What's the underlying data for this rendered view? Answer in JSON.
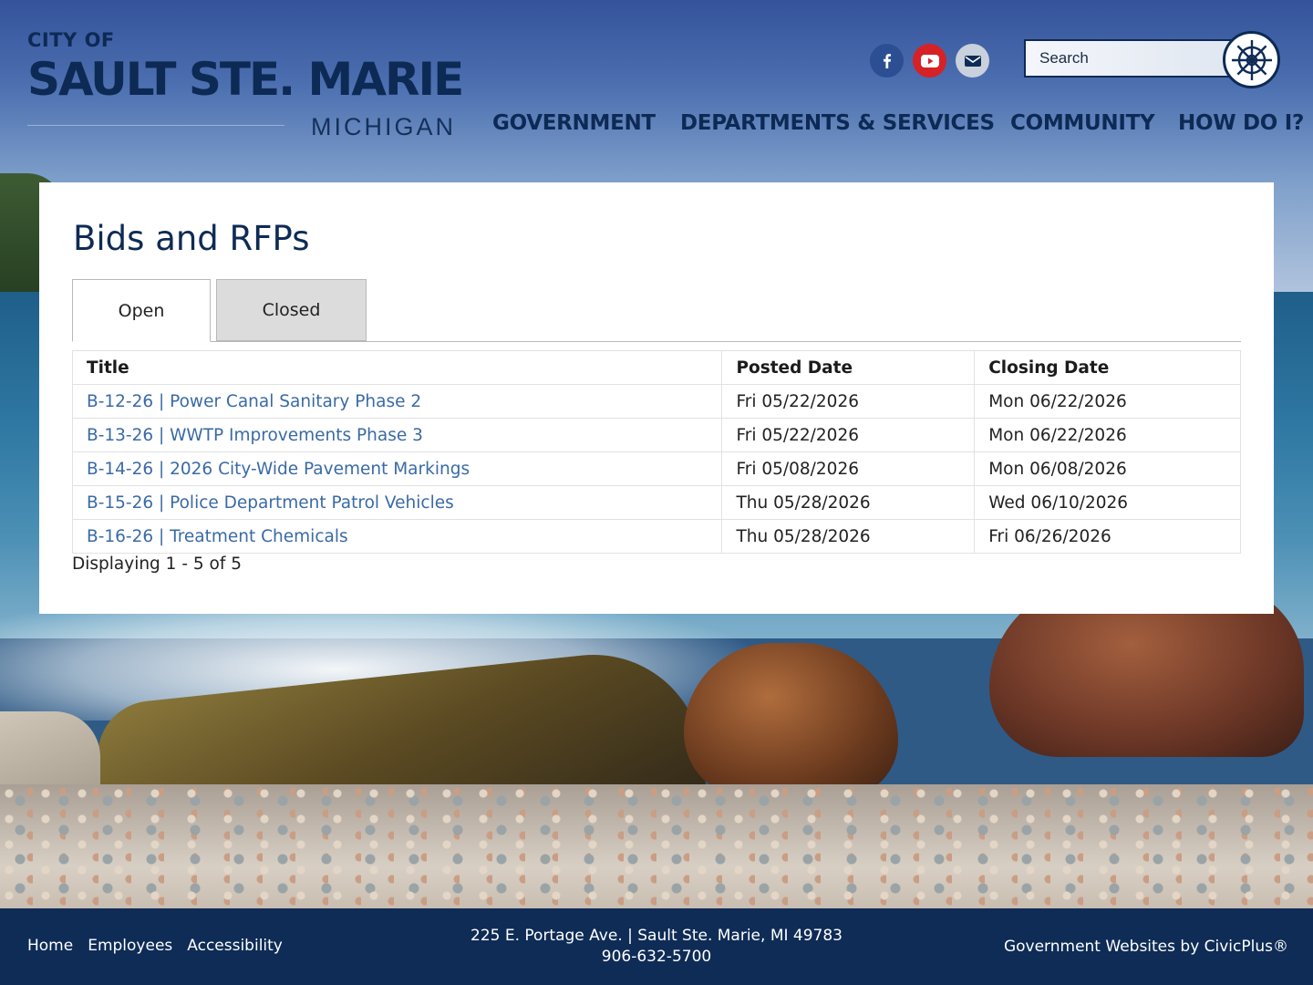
{
  "header": {
    "logo": {
      "city_of": "CITY OF",
      "name": "SAULT STE. MARIE",
      "state": "MICHIGAN"
    },
    "social": [
      {
        "name": "Facebook",
        "icon": "facebook-icon",
        "color": "#2c4f93"
      },
      {
        "name": "YouTube",
        "icon": "youtube-icon",
        "color": "#d62126"
      },
      {
        "name": "Email",
        "icon": "mail-icon",
        "color": "#c9d1dc"
      }
    ],
    "search": {
      "placeholder": "Search",
      "icon": "ships-wheel-icon"
    },
    "nav": [
      "GOVERNMENT",
      "DEPARTMENTS & SERVICES",
      "COMMUNITY",
      "HOW DO I?"
    ]
  },
  "main": {
    "title": "Bids and RFPs",
    "tabs": [
      {
        "label": "Open",
        "active": true
      },
      {
        "label": "Closed",
        "active": false
      }
    ],
    "table": {
      "columns": [
        "Title",
        "Posted Date",
        "Closing Date"
      ],
      "rows": [
        {
          "title": "B-12-26 | Power Canal Sanitary Phase 2",
          "posted": "Fri 05/22/2026",
          "closing": "Mon 06/22/2026"
        },
        {
          "title": "B-13-26 | WWTP Improvements Phase 3",
          "posted": "Fri 05/22/2026",
          "closing": "Mon 06/22/2026"
        },
        {
          "title": "B-14-26 | 2026 City-Wide Pavement Markings",
          "posted": "Fri 05/08/2026",
          "closing": "Mon 06/08/2026"
        },
        {
          "title": "B-15-26 | Police Department Patrol Vehicles",
          "posted": "Thu 05/28/2026",
          "closing": "Wed 06/10/2026"
        },
        {
          "title": "B-16-26 | Treatment Chemicals",
          "posted": "Thu 05/28/2026",
          "closing": "Fri 06/26/2026"
        }
      ]
    },
    "count_text": "Displaying 1 - 5 of 5"
  },
  "footer": {
    "links": [
      "Home",
      "Employees",
      "Accessibility"
    ],
    "address": "225 E. Portage Ave. | Sault Ste. Marie, MI 49783",
    "phone": "906-632-5700",
    "credit": "Government Websites by CivicPlus®"
  },
  "colors": {
    "brand_navy": "#0e2c56",
    "link_blue": "#3a6aa6",
    "tab_inactive": "#dcdcdc"
  }
}
